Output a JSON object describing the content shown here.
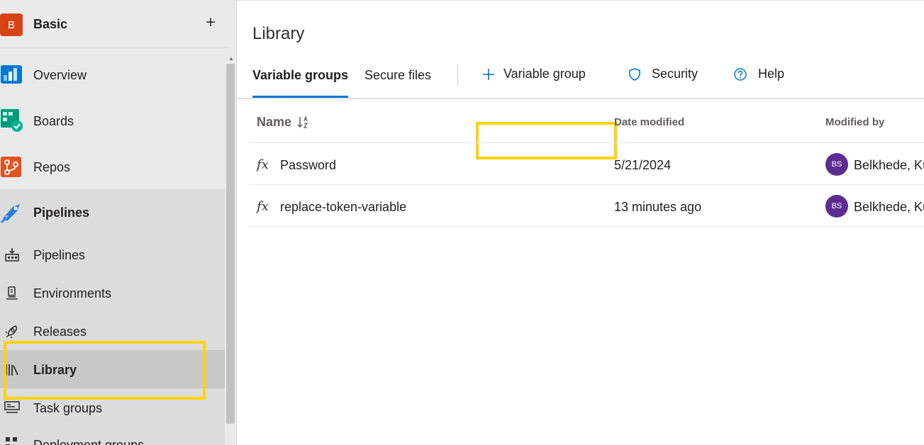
{
  "project": {
    "initial": "B",
    "name": "Basic",
    "add_label": "+"
  },
  "sidebar": {
    "items": [
      {
        "label": "Overview",
        "icon": "overview-icon"
      },
      {
        "label": "Boards",
        "icon": "boards-icon"
      },
      {
        "label": "Repos",
        "icon": "repos-icon"
      },
      {
        "label": "Pipelines",
        "icon": "pipelines-hub-icon"
      },
      {
        "label": "Pipelines",
        "icon": "pipelines-icon"
      },
      {
        "label": "Environments",
        "icon": "environments-icon"
      },
      {
        "label": "Releases",
        "icon": "releases-icon"
      },
      {
        "label": "Library",
        "icon": "library-icon",
        "selected": true
      },
      {
        "label": "Task groups",
        "icon": "task-groups-icon"
      },
      {
        "label": "Deployment groups",
        "icon": "deployment-groups-icon"
      }
    ]
  },
  "main": {
    "title": "Library",
    "tabs": [
      {
        "label": "Variable groups",
        "active": true
      },
      {
        "label": "Secure files",
        "active": false
      }
    ],
    "commands": {
      "add_variable_group": "Variable group",
      "security": "Security",
      "help": "Help"
    },
    "table": {
      "columns": {
        "name": "Name",
        "date": "Date modified",
        "modified_by": "Modified by"
      },
      "rows": [
        {
          "name": "Password",
          "date": "5/21/2024",
          "initials": "BS",
          "modified_by": "Belkhede, Ku"
        },
        {
          "name": "replace-token-variable",
          "date": "13 minutes ago",
          "initials": "BS",
          "modified_by": "Belkhede, Ku"
        }
      ]
    }
  },
  "colors": {
    "accent": "#0078d4",
    "highlight": "#ffd200",
    "project_badge": "#d84315",
    "avatar": "#5c2d91"
  }
}
